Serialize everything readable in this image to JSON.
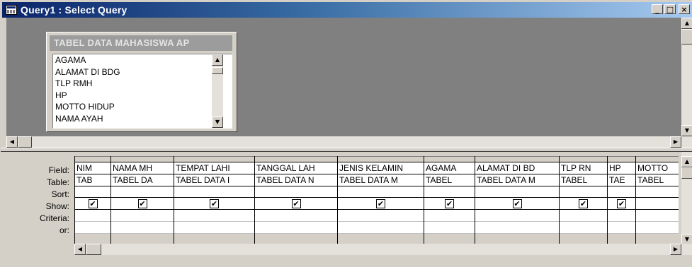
{
  "window": {
    "title": "Query1 : Select Query",
    "minimize_glyph": "_",
    "maximize_glyph": "□",
    "close_glyph": "×"
  },
  "table_field_list": {
    "title": "TABEL DATA MAHASISWA AP",
    "fields": [
      "AGAMA",
      "ALAMAT DI BDG",
      "TLP RMH",
      "HP",
      "MOTTO HIDUP",
      "NAMA AYAH"
    ]
  },
  "design_grid": {
    "row_labels": [
      "Field:",
      "Table:",
      "Sort:",
      "Show:",
      "Criteria:",
      "or:"
    ],
    "columns": [
      {
        "field": "NIM",
        "table": "TAB",
        "show": true
      },
      {
        "field": "NAMA MH",
        "table": "TABEL DA",
        "show": true
      },
      {
        "field": "TEMPAT LAHI",
        "table": "TABEL DATA I",
        "show": true
      },
      {
        "field": "TANGGAL LAH",
        "table": "TABEL DATA N",
        "show": true
      },
      {
        "field": "JENIS KELAMIN",
        "table": "TABEL DATA M",
        "show": true
      },
      {
        "field": "AGAMA",
        "table": "TABEL",
        "show": true
      },
      {
        "field": "ALAMAT DI BD",
        "table": "TABEL DATA M",
        "show": true
      },
      {
        "field": "TLP RN",
        "table": "TABEL",
        "show": true
      },
      {
        "field": "HP",
        "table": "TAE",
        "show": true
      },
      {
        "field": "MOTTO",
        "table": "TABEL",
        "show": false
      }
    ]
  },
  "scroll_glyphs": {
    "up": "▲",
    "down": "▼",
    "left": "◀",
    "right": "▶"
  }
}
